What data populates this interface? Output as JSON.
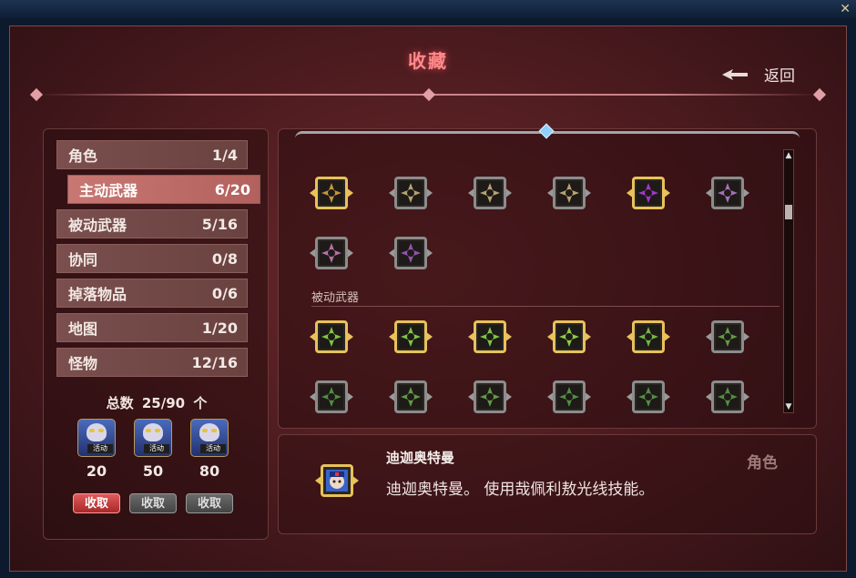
{
  "window": {
    "close_glyph": "✕"
  },
  "title": "收藏",
  "back_label": "返回",
  "categories": [
    {
      "label": "角色",
      "count": "1/4"
    },
    {
      "label": "主动武器",
      "count": "6/20"
    },
    {
      "label": "被动武器",
      "count": "5/16"
    },
    {
      "label": "协同",
      "count": "0/8"
    },
    {
      "label": "掉落物品",
      "count": "0/6"
    },
    {
      "label": "地图",
      "count": "1/20"
    },
    {
      "label": "怪物",
      "count": "12/16"
    }
  ],
  "total": {
    "label": "总数",
    "value": "25/90",
    "unit": "个"
  },
  "rewards": [
    {
      "badge": "活动",
      "count": "20",
      "button": "收取",
      "state": "available"
    },
    {
      "badge": "活动",
      "count": "50",
      "button": "收取",
      "state": "locked"
    },
    {
      "badge": "活动",
      "count": "80",
      "button": "收取",
      "state": "locked"
    }
  ],
  "grid": {
    "active_weapons": [
      {
        "icon": "golden-claw-icon",
        "frame": "gold",
        "color": "#d9a43a"
      },
      {
        "icon": "crosshair-icon",
        "frame": "silver",
        "color": "#c9b27a"
      },
      {
        "icon": "eye-icon",
        "frame": "silver",
        "color": "#c9b27a"
      },
      {
        "icon": "drill-icon",
        "frame": "silver",
        "color": "#c9b27a"
      },
      {
        "icon": "purple-slash-icon",
        "frame": "gold",
        "color": "#b53ad9"
      },
      {
        "icon": "purple-ribbon-icon",
        "frame": "silver",
        "color": "#b57ac9"
      },
      {
        "icon": "purple-wings-icon",
        "frame": "silver",
        "color": "#c97ab5"
      },
      {
        "icon": "purple-spear-icon",
        "frame": "silver",
        "color": "#a05ac0"
      }
    ],
    "passive_section_label": "被动武器",
    "passive_weapons": [
      {
        "icon": "green-burst-icon",
        "frame": "gold",
        "color": "#8ad94a"
      },
      {
        "icon": "green-burst-icon",
        "frame": "gold",
        "color": "#8ad94a"
      },
      {
        "icon": "green-burst-icon",
        "frame": "gold",
        "color": "#8ad94a"
      },
      {
        "icon": "green-sun-icon",
        "frame": "gold",
        "color": "#9ae04a"
      },
      {
        "icon": "green-robot-icon",
        "frame": "gold",
        "color": "#7ac94a"
      },
      {
        "icon": "green-cannon-icon",
        "frame": "silver",
        "color": "#6aa84a"
      },
      {
        "icon": "green-mech-icon",
        "frame": "silver",
        "color": "#5a9a4a"
      },
      {
        "icon": "green-magnifier-icon",
        "frame": "silver",
        "color": "#6aa84a"
      },
      {
        "icon": "green-fan-icon",
        "frame": "silver",
        "color": "#6aa84a"
      },
      {
        "icon": "green-orb-icon",
        "frame": "silver",
        "color": "#5a9a4a"
      },
      {
        "icon": "green-hammer-icon",
        "frame": "silver",
        "color": "#5a9a4a"
      },
      {
        "icon": "green-gear-icon",
        "frame": "silver",
        "color": "#5a9a4a"
      }
    ]
  },
  "detail": {
    "name": "迪迦奥特曼",
    "description": "迪迦奥特曼。 使用哉佩利敖光线技能。",
    "category": "角色",
    "icon": "tiga-portrait-icon"
  }
}
